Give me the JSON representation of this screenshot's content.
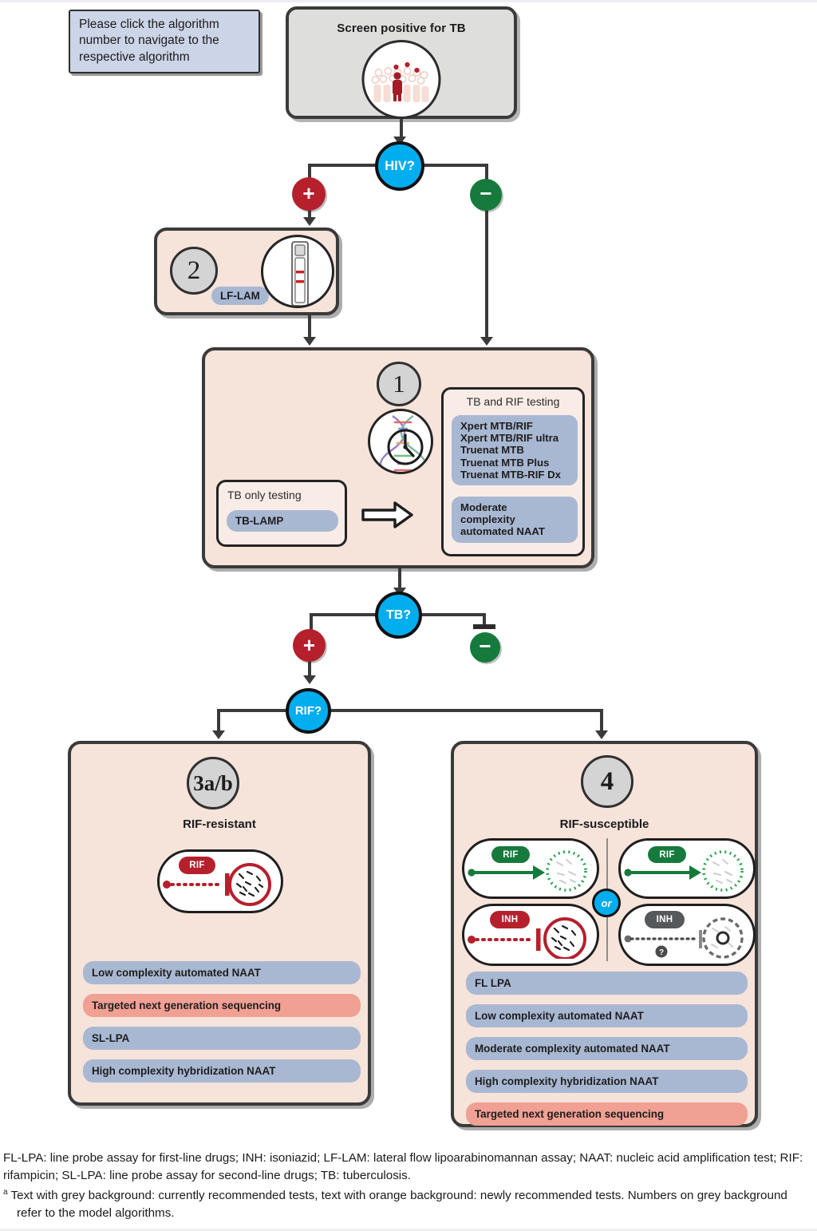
{
  "hint": {
    "text": "Please click the algorithm number to navigate to the respective algorithm"
  },
  "screen_node": {
    "title": "Screen positive for TB",
    "icon": "crowd-people-icon"
  },
  "decisions": {
    "hiv": {
      "label": "HIV?",
      "positive": "+",
      "negative": "−"
    },
    "tb": {
      "label": "TB?",
      "positive": "+",
      "negative": "−"
    },
    "rif": {
      "label": "RIF?"
    }
  },
  "algorithm2": {
    "number": "2",
    "icon": "lateral-flow-strip-icon",
    "test": "LF-LAM"
  },
  "algorithm1": {
    "number": "1",
    "icon": "dna-clock-icon",
    "tb_only": {
      "title": "TB only testing",
      "tests": [
        "TB-LAMP"
      ]
    },
    "arrow": "right-arrow-icon",
    "tb_and_rif": {
      "title": "TB and RIF testing",
      "group1": "Xpert MTB/RIF\nXpert MTB/RIF ultra\nTruenat MTB\nTruenat MTB Plus\nTruenat MTB-RIF Dx",
      "group1_lines": [
        "Xpert MTB/RIF",
        "Xpert MTB/RIF ultra",
        "Truenat MTB",
        "Truenat MTB Plus",
        "Truenat MTB-RIF Dx"
      ],
      "group2_lines": [
        "Moderate",
        "complexity",
        "automated NAAT"
      ]
    }
  },
  "algorithm3": {
    "number": "3a/b",
    "subtitle": "RIF-resistant",
    "icon": {
      "drug": "RIF",
      "state": "resistant-bacteria-blocked-icon"
    },
    "tests": [
      {
        "label": "Low complexity automated NAAT",
        "style": "grey"
      },
      {
        "label": "Targeted next generation sequencing",
        "style": "orange"
      },
      {
        "label": "SL-LPA",
        "style": "grey"
      },
      {
        "label": "High complexity hybridization NAAT",
        "style": "grey"
      }
    ]
  },
  "algorithm4": {
    "number": "4",
    "subtitle": "RIF-susceptible",
    "or_label": "or",
    "icons": [
      {
        "drug": "RIF",
        "state": "susceptible-icon",
        "position": "top-left"
      },
      {
        "drug": "RIF",
        "state": "susceptible-icon",
        "position": "top-right"
      },
      {
        "drug": "INH",
        "state": "resistant-bacteria-blocked-icon",
        "position": "bottom-left"
      },
      {
        "drug": "INH",
        "state": "unknown-icon",
        "position": "bottom-right",
        "marker": "?"
      }
    ],
    "tests": [
      {
        "label": "FL LPA",
        "style": "grey"
      },
      {
        "label": "Low complexity automated NAAT",
        "style": "grey"
      },
      {
        "label": "Moderate complexity automated NAAT",
        "style": "grey"
      },
      {
        "label": "High complexity hybridization NAAT",
        "style": "grey"
      },
      {
        "label": "Targeted next generation sequencing",
        "style": "orange"
      }
    ]
  },
  "footnotes": {
    "abbrev": "FL-LPA: line probe assay for first-line drugs; INH: isoniazid; LF-LAM: lateral flow lipoarabinomannan assay; NAAT: nucleic acid amplification test; RIF: rifampicin; SL-LPA: line probe assay for second-line drugs; TB: tuberculosis.",
    "note_marker": "a",
    "note": "Text with grey background: currently recommended tests, text with orange background: newly recommended tests. Numbers on grey background refer to the model algorithms."
  },
  "colors": {
    "decision_blue": "#00adef",
    "positive_red": "#b5202c",
    "negative_green": "#157a3c",
    "panel_peach": "#f6e3da",
    "pill_grey_blue": "#a9b8d2",
    "pill_orange": "#f1a094",
    "bubble_grey": "#d4d4d4",
    "hint_blue": "#ccd4e8",
    "screen_grey": "#dededd"
  }
}
